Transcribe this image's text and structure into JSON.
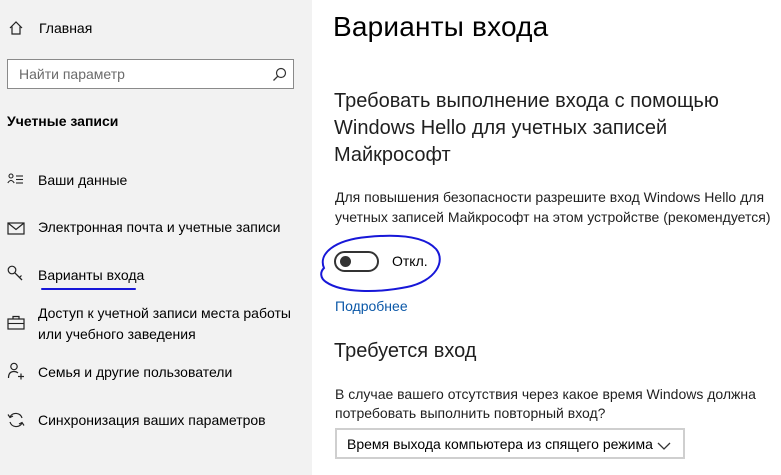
{
  "sidebar": {
    "home_label": "Главная",
    "search_placeholder": "Найти параметр",
    "section_title": "Учетные записи",
    "items": [
      {
        "label": "Ваши данные",
        "icon": "person-list-icon"
      },
      {
        "label": "Электронная почта и учетные записи",
        "icon": "mail-icon"
      },
      {
        "label": "Варианты входа",
        "icon": "key-icon"
      },
      {
        "label": "Доступ к учетной записи места работы или учебного заведения",
        "icon": "briefcase-icon"
      },
      {
        "label": "Семья и другие пользователи",
        "icon": "person-add-icon"
      },
      {
        "label": "Синхронизация ваших параметров",
        "icon": "sync-icon"
      }
    ]
  },
  "main": {
    "title": "Варианты входа",
    "hello_heading": "Требовать выполнение входа с помощью Windows Hello для учетных записей Майкрософт",
    "hello_desc": "Для повышения безопасности разрешите вход Windows Hello для учетных записей Майкрософт на этом устройстве (рекомендуется)",
    "toggle_state": "Откл.",
    "more_link": "Подробнее",
    "signin_heading": "Требуется вход",
    "signin_desc": "В случае вашего отсутствия через какое время Windows должна потребовать выполнить повторный вход?",
    "signin_select_value": "Время выхода компьютера из спящего режима"
  },
  "colors": {
    "sidebar_bg": "#f2f2f2",
    "link": "#0b58a8",
    "annotation": "#1717d8"
  }
}
